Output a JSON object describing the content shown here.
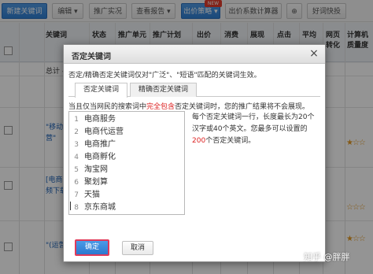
{
  "toolbar": {
    "buttons": [
      {
        "label": "新建关键词"
      },
      {
        "label": "编辑 ▾"
      },
      {
        "label": "推广实况"
      },
      {
        "label": "查看报告 ▾"
      },
      {
        "label": "出价策略 ▾"
      },
      {
        "label": "出价系数计算器"
      },
      {
        "label": "⊕"
      },
      {
        "label": "好词快投"
      }
    ],
    "new_badge": "NEW"
  },
  "grid": {
    "headers": [
      "关键词",
      "状态",
      "推广单元",
      "推广计划",
      "出价",
      "消费",
      "展现",
      "点击",
      "平均",
      "网页转化",
      "计算机质量度"
    ],
    "rows": [
      {
        "keyword": "总计 -",
        "stars": ""
      },
      {
        "keyword": "\"移动",
        "keyword2": "营\"",
        "stars": "★☆☆"
      },
      {
        "keyword": "[电商",
        "keyword2": "频下载",
        "stars": "☆☆☆"
      },
      {
        "keyword": "\"(运营",
        "stars": "★☆☆"
      }
    ]
  },
  "modal": {
    "title": "否定关键词",
    "close_icon": "×",
    "notice": "否定/精确否定关键词仅对\"广泛\"、\"短语\"匹配的关键词生效。",
    "tabs": [
      {
        "label": "否定关键词",
        "active": true
      },
      {
        "label": "精确否定关键词",
        "active": false
      }
    ],
    "hint_prefix": "当且仅当网民的搜索词中",
    "hint_red": "完全包含",
    "hint_suffix": "否定关键词时，您的推广结果将不会展现。",
    "keywords": [
      {
        "num": "1",
        "text": "电商服务"
      },
      {
        "num": "2",
        "text": "电商代运营"
      },
      {
        "num": "3",
        "text": "电商推广"
      },
      {
        "num": "4",
        "text": "电商孵化"
      },
      {
        "num": "5",
        "text": "淘宝网"
      },
      {
        "num": "6",
        "text": "聚划算"
      },
      {
        "num": "7",
        "text": "天猫"
      },
      {
        "num": "8",
        "text": "京东商城"
      }
    ],
    "desc_1": "每个否定关键词一行，长度最长为20个汉字或40个英文。您最多可以设置的",
    "desc_red": "200",
    "desc_2": "个否定关键词。",
    "ok_label": "确定",
    "cancel_label": "取消"
  },
  "watermark": "知乎 @胖胖"
}
